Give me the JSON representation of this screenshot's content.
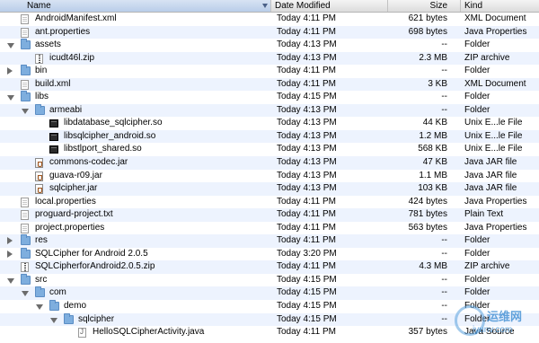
{
  "header": {
    "name": "Name",
    "date": "Date Modified",
    "size": "Size",
    "kind": "Kind"
  },
  "rows": [
    {
      "name": "AndroidManifest.xml",
      "date": "Today 4:11 PM",
      "size": "621 bytes",
      "kind": "XML Document",
      "icon": "doc-icon",
      "depth": 1,
      "tri": "none"
    },
    {
      "name": "ant.properties",
      "date": "Today 4:11 PM",
      "size": "698 bytes",
      "kind": "Java Properties",
      "icon": "doc-icon",
      "depth": 1,
      "tri": "none"
    },
    {
      "name": "assets",
      "date": "Today 4:13 PM",
      "size": "--",
      "kind": "Folder",
      "icon": "folder-icon",
      "depth": 1,
      "tri": "open"
    },
    {
      "name": "icudt46l.zip",
      "date": "Today 4:13 PM",
      "size": "2.3 MB",
      "kind": "ZIP archive",
      "icon": "zip-icon",
      "depth": 2,
      "tri": "none"
    },
    {
      "name": "bin",
      "date": "Today 4:11 PM",
      "size": "--",
      "kind": "Folder",
      "icon": "folder-icon",
      "depth": 1,
      "tri": "closed"
    },
    {
      "name": "build.xml",
      "date": "Today 4:11 PM",
      "size": "3 KB",
      "kind": "XML Document",
      "icon": "doc-icon",
      "depth": 1,
      "tri": "none"
    },
    {
      "name": "libs",
      "date": "Today 4:15 PM",
      "size": "--",
      "kind": "Folder",
      "icon": "folder-icon",
      "depth": 1,
      "tri": "open"
    },
    {
      "name": "armeabi",
      "date": "Today 4:13 PM",
      "size": "--",
      "kind": "Folder",
      "icon": "folder-icon",
      "depth": 2,
      "tri": "open"
    },
    {
      "name": "libdatabase_sqlcipher.so",
      "date": "Today 4:13 PM",
      "size": "44 KB",
      "kind": "Unix E...le File",
      "icon": "exec-icon",
      "depth": 3,
      "tri": "none"
    },
    {
      "name": "libsqlcipher_android.so",
      "date": "Today 4:13 PM",
      "size": "1.2 MB",
      "kind": "Unix E...le File",
      "icon": "exec-icon",
      "depth": 3,
      "tri": "none"
    },
    {
      "name": "libstlport_shared.so",
      "date": "Today 4:13 PM",
      "size": "568 KB",
      "kind": "Unix E...le File",
      "icon": "exec-icon",
      "depth": 3,
      "tri": "none"
    },
    {
      "name": "commons-codec.jar",
      "date": "Today 4:13 PM",
      "size": "47 KB",
      "kind": "Java JAR file",
      "icon": "jar-icon",
      "depth": 2,
      "tri": "none"
    },
    {
      "name": "guava-r09.jar",
      "date": "Today 4:13 PM",
      "size": "1.1 MB",
      "kind": "Java JAR file",
      "icon": "jar-icon",
      "depth": 2,
      "tri": "none"
    },
    {
      "name": "sqlcipher.jar",
      "date": "Today 4:13 PM",
      "size": "103 KB",
      "kind": "Java JAR file",
      "icon": "jar-icon",
      "depth": 2,
      "tri": "none"
    },
    {
      "name": "local.properties",
      "date": "Today 4:11 PM",
      "size": "424 bytes",
      "kind": "Java Properties",
      "icon": "doc-icon",
      "depth": 1,
      "tri": "none"
    },
    {
      "name": "proguard-project.txt",
      "date": "Today 4:11 PM",
      "size": "781 bytes",
      "kind": "Plain Text",
      "icon": "doc-icon",
      "depth": 1,
      "tri": "none"
    },
    {
      "name": "project.properties",
      "date": "Today 4:11 PM",
      "size": "563 bytes",
      "kind": "Java Properties",
      "icon": "doc-icon",
      "depth": 1,
      "tri": "none"
    },
    {
      "name": "res",
      "date": "Today 4:11 PM",
      "size": "--",
      "kind": "Folder",
      "icon": "folder-icon",
      "depth": 1,
      "tri": "closed"
    },
    {
      "name": "SQLCipher for Android 2.0.5",
      "date": "Today 3:20 PM",
      "size": "--",
      "kind": "Folder",
      "icon": "folder-icon",
      "depth": 1,
      "tri": "closed"
    },
    {
      "name": "SQLCipherforAndroid2.0.5.zip",
      "date": "Today 4:11 PM",
      "size": "4.3 MB",
      "kind": "ZIP archive",
      "icon": "zip-icon",
      "depth": 1,
      "tri": "none"
    },
    {
      "name": "src",
      "date": "Today 4:15 PM",
      "size": "--",
      "kind": "Folder",
      "icon": "folder-icon",
      "depth": 1,
      "tri": "open"
    },
    {
      "name": "com",
      "date": "Today 4:15 PM",
      "size": "--",
      "kind": "Folder",
      "icon": "folder-icon",
      "depth": 2,
      "tri": "open"
    },
    {
      "name": "demo",
      "date": "Today 4:15 PM",
      "size": "--",
      "kind": "Folder",
      "icon": "folder-icon",
      "depth": 3,
      "tri": "open"
    },
    {
      "name": "sqlcipher",
      "date": "Today 4:15 PM",
      "size": "--",
      "kind": "Folder",
      "icon": "folder-icon",
      "depth": 4,
      "tri": "open"
    },
    {
      "name": "HelloSQLCipherActivity.java",
      "date": "Today 4:11 PM",
      "size": "357 bytes",
      "kind": "Java Source",
      "icon": "java-icon",
      "depth": 5,
      "tri": "none"
    }
  ],
  "watermark": {
    "cn": "运维网",
    "url": "iyunv.com"
  }
}
